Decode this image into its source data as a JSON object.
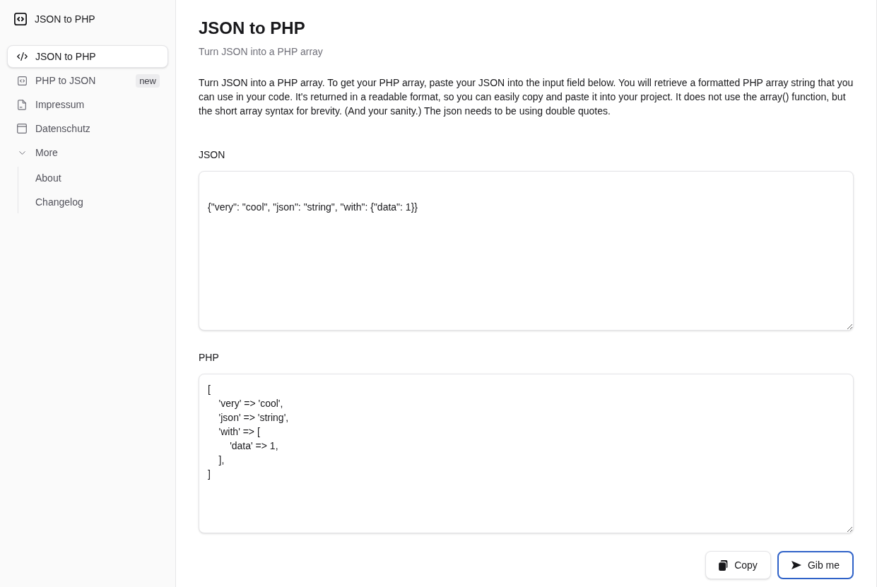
{
  "sidebar": {
    "title": "JSON to PHP",
    "items": [
      {
        "kind": "link",
        "label": "JSON to PHP",
        "selected": true
      },
      {
        "kind": "link",
        "label": "PHP to JSON",
        "badge": "new",
        "selected": false
      },
      {
        "kind": "link",
        "label": "Impressum",
        "selected": false
      },
      {
        "kind": "link",
        "label": "Datenschutz",
        "selected": false
      },
      {
        "kind": "group",
        "label": "More",
        "expanded": true,
        "selected": false,
        "children": [
          {
            "label": "About",
            "selected": false
          },
          {
            "label": "Changelog",
            "selected": false
          }
        ]
      }
    ]
  },
  "page": {
    "title": "JSON to PHP",
    "subtitle": "Turn JSON into a PHP array",
    "description": "Turn JSON into a PHP array. To get your PHP array, paste your JSON into the input field below. You will retrieve a formatted PHP array string that you can use in your code. It's returned in a readable format, so you can easily copy and paste it into your project. It does not use the array() function, but the short array syntax for brevity. (And your sanity.) The json needs to be using double quotes."
  },
  "fields": [
    {
      "label": "JSON",
      "value": "{\"very\": \"cool\", \"json\": \"string\", \"with\": {\"data\": 1}}"
    },
    {
      "label": "PHP",
      "value": "[\n    'very' => 'cool',\n    'json' => 'string',\n    'with' => [\n        'data' => 1,\n    ],\n]"
    }
  ],
  "buttons": [
    {
      "kind": "copy",
      "label": "Copy",
      "focused": false
    },
    {
      "kind": "submit",
      "label": "Gib me",
      "focused": true
    }
  ]
}
